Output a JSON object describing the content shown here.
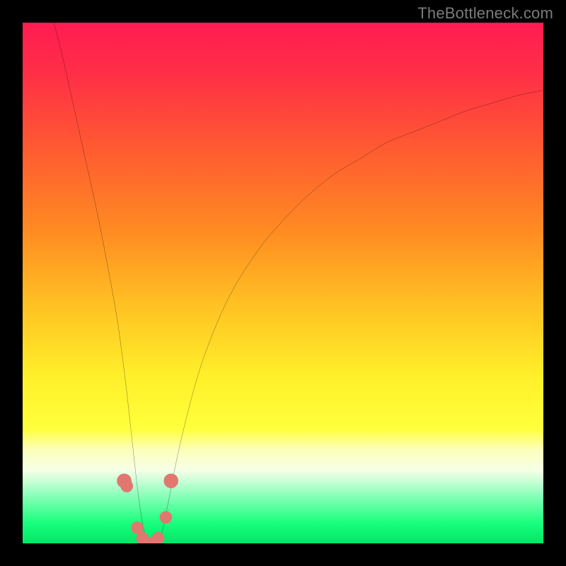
{
  "watermark": {
    "text": "TheBottleneck.com"
  },
  "chart_data": {
    "type": "line",
    "title": "",
    "xlabel": "",
    "ylabel": "",
    "xlim": [
      0,
      100
    ],
    "ylim": [
      0,
      100
    ],
    "gradient_stops": [
      {
        "offset": 0.0,
        "color": "#ff1c52"
      },
      {
        "offset": 0.1,
        "color": "#ff2f46"
      },
      {
        "offset": 0.25,
        "color": "#ff5d30"
      },
      {
        "offset": 0.4,
        "color": "#ff8b22"
      },
      {
        "offset": 0.55,
        "color": "#ffc423"
      },
      {
        "offset": 0.68,
        "color": "#fff02a"
      },
      {
        "offset": 0.78,
        "color": "#ffff3b"
      },
      {
        "offset": 0.82,
        "color": "#fcffba"
      },
      {
        "offset": 0.86,
        "color": "#f6ffe7"
      },
      {
        "offset": 0.9,
        "color": "#9bffc2"
      },
      {
        "offset": 0.96,
        "color": "#1aff7e"
      },
      {
        "offset": 1.0,
        "color": "#00e765"
      }
    ],
    "series": [
      {
        "name": "bottleneck-curve",
        "x": [
          6,
          8,
          10,
          12,
          14,
          16,
          18,
          19,
          20,
          21,
          22,
          23,
          24,
          25,
          26,
          27,
          28,
          30,
          33,
          36,
          40,
          45,
          50,
          55,
          60,
          65,
          70,
          75,
          80,
          85,
          90,
          95,
          100
        ],
        "y": [
          100,
          92,
          83,
          74,
          65,
          55,
          44,
          37,
          29,
          20,
          11,
          4,
          0,
          0,
          0,
          3,
          8,
          18,
          30,
          39,
          48,
          56,
          62,
          67,
          71,
          74,
          77,
          79,
          81,
          83,
          84.5,
          86,
          87
        ]
      }
    ],
    "markers": [
      {
        "x": 19.5,
        "y": 12,
        "r": 1.4
      },
      {
        "x": 20.0,
        "y": 11,
        "r": 1.2
      },
      {
        "x": 22.0,
        "y": 3,
        "r": 1.2
      },
      {
        "x": 23.0,
        "y": 1,
        "r": 1.2
      },
      {
        "x": 24.5,
        "y": 0,
        "r": 1.2
      },
      {
        "x": 26.0,
        "y": 1,
        "r": 1.2
      },
      {
        "x": 27.5,
        "y": 5,
        "r": 1.2
      },
      {
        "x": 28.5,
        "y": 12,
        "r": 1.4
      }
    ],
    "marker_color": "#e2776f"
  }
}
